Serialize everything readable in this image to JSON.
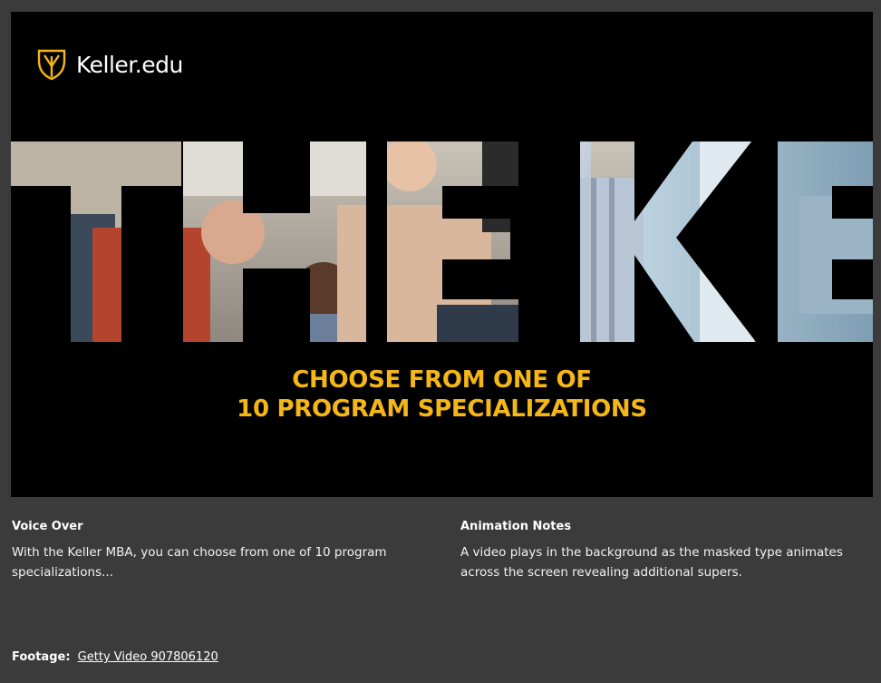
{
  "frame": {
    "brand": {
      "name": "Keller.edu",
      "icon": "keller-shield-logo",
      "accent": "#f5b617"
    },
    "masked_type": {
      "text": "THE KE",
      "fill": "video-footage-of-office-team",
      "background": "#000000"
    },
    "supers": {
      "line1": "CHOOSE FROM ONE OF",
      "line2": "10 PROGRAM SPECIALIZATIONS",
      "color": "#f5b617"
    }
  },
  "voice_over": {
    "title": "Voice Over",
    "body": "With the Keller MBA, you can choose from one of 10 program specializations..."
  },
  "animation_notes": {
    "title": "Animation Notes",
    "body": "A video plays in the background as the masked type animates across the screen revealing additional supers."
  },
  "footage": {
    "label": "Footage:",
    "link_text": "Getty Video 907806120"
  }
}
